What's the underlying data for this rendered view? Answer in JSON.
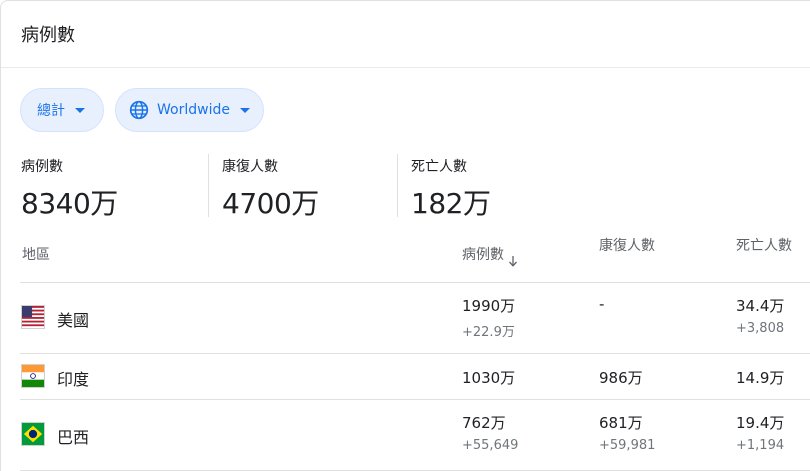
{
  "header": {
    "title": "病例數"
  },
  "filters": {
    "metric": {
      "label": "總計"
    },
    "region": {
      "label": "Worldwide"
    }
  },
  "summary": [
    {
      "label": "病例數",
      "value": "8340万"
    },
    {
      "label": "康復人數",
      "value": "4700万"
    },
    {
      "label": "死亡人數",
      "value": "182万"
    }
  ],
  "table": {
    "headers": {
      "region": "地區",
      "cases": "病例數",
      "recovered": "康復人數",
      "deaths": "死亡人數"
    },
    "rows": [
      {
        "country": "美國",
        "flag": "us-flag-icon",
        "cases": "1990万",
        "cases_new": "+22.9万",
        "recovered": "-",
        "recovered_new": "",
        "deaths": "34.4万",
        "deaths_new": "+3,808"
      },
      {
        "country": "印度",
        "flag": "india-flag-icon",
        "cases": "1030万",
        "cases_new": "",
        "recovered": "986万",
        "recovered_new": "",
        "deaths": "14.9万",
        "deaths_new": ""
      },
      {
        "country": "巴西",
        "flag": "brazil-flag-icon",
        "cases": "762万",
        "cases_new": "+55,649",
        "recovered": "681万",
        "recovered_new": "+59,981",
        "deaths": "19.4万",
        "deaths_new": "+1,194"
      }
    ]
  },
  "colors": {
    "accent": "#1a73e8",
    "chip_bg": "#e8f0fe",
    "secondary_text": "#70757a"
  }
}
